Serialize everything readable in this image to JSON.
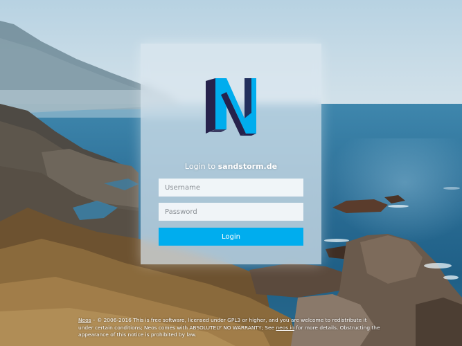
{
  "login": {
    "title_prefix": "Login to ",
    "site_name": "sandstorm.de",
    "username_placeholder": "Username",
    "password_placeholder": "Password",
    "button_label": "Login"
  },
  "footer": {
    "neos_link": "Neos",
    "text_1": " – © 2006-2016 This is free software, licensed under GPL3 or higher, and you are welcome to redistribute it under certain conditions; Neos comes with ABSOLUTELY NO WARRANTY; See ",
    "neos_io_link": "neos.io",
    "text_2": " for more details. Obstructing the appearance of this notice is prohibited by law."
  },
  "colors": {
    "accent": "#00adee",
    "logo_dark": "#26224c",
    "logo_light": "#00adee"
  },
  "icons": {
    "logo": "neos-logo"
  }
}
